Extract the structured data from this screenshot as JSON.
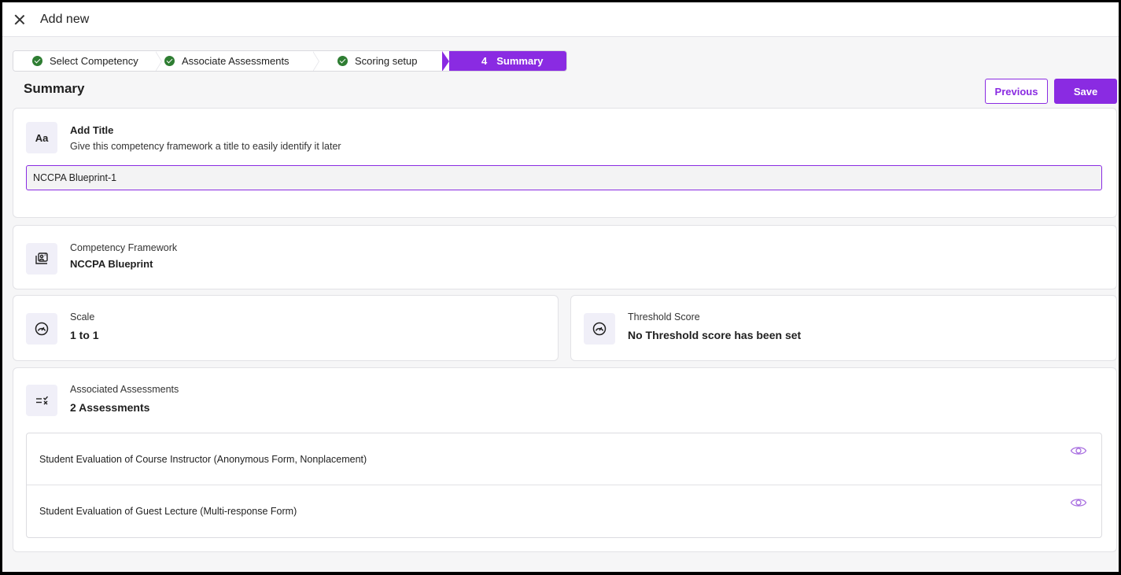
{
  "header": {
    "title": "Add new",
    "close_icon": "close-icon"
  },
  "stepper": {
    "steps": [
      {
        "label": "Select Competency",
        "status": "complete"
      },
      {
        "label": "Associate Assessments",
        "status": "complete"
      },
      {
        "label": "Scoring setup",
        "status": "complete"
      },
      {
        "number": "4",
        "label": "Summary",
        "status": "active"
      }
    ]
  },
  "page": {
    "title": "Summary"
  },
  "actions": {
    "previous_label": "Previous",
    "save_label": "Save"
  },
  "title_card": {
    "icon_text": "Aa",
    "heading": "Add Title",
    "description": "Give this competency framework a title to easily identify it later",
    "input_value": "NCCPA Blueprint-1"
  },
  "framework_card": {
    "label": "Competency Framework",
    "value": "NCCPA Blueprint"
  },
  "scale_card": {
    "label": "Scale",
    "value": "1 to 1"
  },
  "threshold_card": {
    "label": "Threshold Score",
    "value": "No Threshold score has been set"
  },
  "assessments_card": {
    "label": "Associated Assessments",
    "value": "2 Assessments",
    "items": [
      "Student Evaluation of Course Instructor (Anonymous Form, Nonplacement)",
      "Student Evaluation of Guest Lecture (Multi-response Form)"
    ]
  },
  "colors": {
    "accent": "#8a2be2",
    "success": "#2e7d32"
  }
}
